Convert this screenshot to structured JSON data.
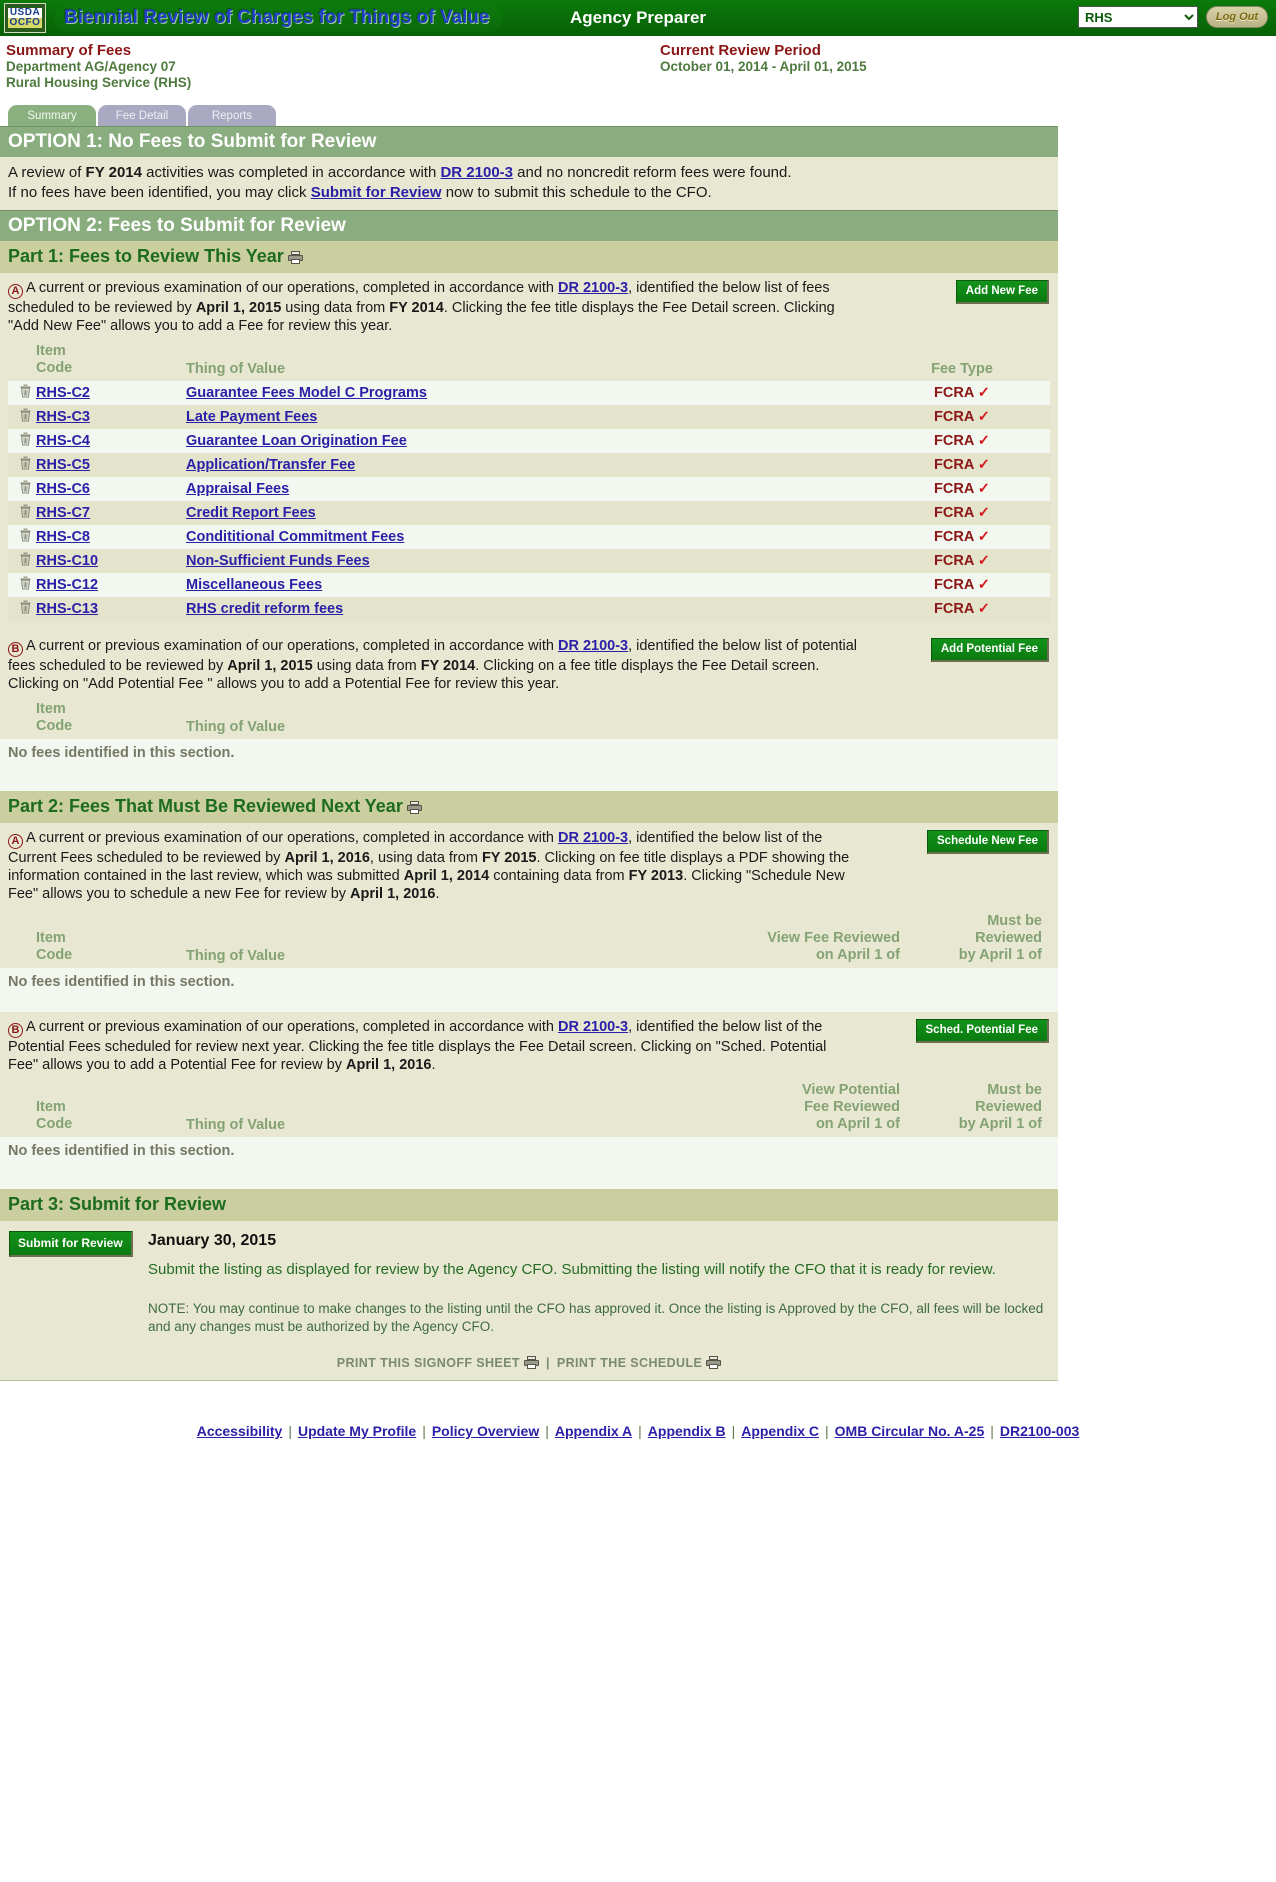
{
  "header": {
    "logo_line1": "USDA",
    "logo_line2": "OCFO",
    "app_title": "Biennial Review of Charges for Things of Value",
    "role": "Agency Preparer",
    "agency_selected": "RHS",
    "agency_options": [
      "RHS"
    ],
    "logout_label": "Log Out"
  },
  "titles": {
    "left_title": "Summary of Fees",
    "left_line2": "Department AG/Agency 07",
    "left_line3": "Rural Housing Service (RHS)",
    "right_title": "Current Review Period",
    "right_line2": "October 01, 2014 - April 01, 2015"
  },
  "tabs": [
    {
      "label": "Summary",
      "active": true
    },
    {
      "label": "Fee Detail",
      "active": false
    },
    {
      "label": "Reports",
      "active": false
    }
  ],
  "option1": {
    "heading": "OPTION 1: No Fees to Submit for Review",
    "line1_a": "A review of ",
    "line1_fy": "FY 2014",
    "line1_b": " activities was completed in accordance with ",
    "line1_link": "DR 2100-3",
    "line1_c": " and no noncredit reform fees were found.",
    "line2_a": "If no fees have been identified, you may click ",
    "line2_link": "Submit for Review",
    "line2_b": " now to submit this schedule to the CFO."
  },
  "option2": {
    "heading": "OPTION 2: Fees to Submit for Review"
  },
  "part1": {
    "heading": "Part 1: Fees to Review This Year",
    "sectionA": {
      "marker": "A",
      "text_1": "A current or previous examination of our operations, completed in accordance with ",
      "link": "DR 2100-3",
      "text_2": ", identified the below list of fees scheduled to be reviewed by ",
      "bold_1": "April 1, 2015",
      "text_3": " using data from ",
      "bold_2": "FY 2014",
      "text_4": ". Clicking the fee title displays the Fee Detail screen. Clicking \"Add New Fee\" allows you to add a Fee for review this year.",
      "button": "Add New Fee",
      "columns": {
        "item_code": "Item\nCode",
        "thing_of_value": "Thing of Value",
        "fee_type": "Fee Type"
      },
      "rows": [
        {
          "code": "RHS-C2",
          "name": "Guarantee Fees Model C Programs",
          "fee_type": "FCRA",
          "check": "✓"
        },
        {
          "code": "RHS-C3",
          "name": "Late Payment Fees",
          "fee_type": "FCRA",
          "check": "✓"
        },
        {
          "code": "RHS-C4",
          "name": "Guarantee Loan Origination Fee",
          "fee_type": "FCRA",
          "check": "✓"
        },
        {
          "code": "RHS-C5",
          "name": "Application/Transfer Fee",
          "fee_type": "FCRA",
          "check": "✓"
        },
        {
          "code": "RHS-C6",
          "name": "Appraisal Fees",
          "fee_type": "FCRA",
          "check": "✓"
        },
        {
          "code": "RHS-C7",
          "name": "Credit Report Fees",
          "fee_type": "FCRA",
          "check": "✓"
        },
        {
          "code": "RHS-C8",
          "name": "Conditition​al Commitment Fees",
          "fee_type": "FCRA",
          "check": "✓"
        },
        {
          "code": "RHS-C10",
          "name": "Non-Sufficient Funds Fees",
          "fee_type": "FCRA",
          "check": "✓"
        },
        {
          "code": "RHS-C12",
          "name": "Miscellaneous Fees",
          "fee_type": "FCRA",
          "check": "✓"
        },
        {
          "code": "RHS-C13",
          "name": "RHS credit reform fees",
          "fee_type": "FCRA",
          "check": "✓"
        }
      ]
    },
    "sectionB": {
      "marker": "B",
      "text_1": "A current or previous examination of our operations, completed in accordance with ",
      "link": "DR 2100-3",
      "text_2": ", identified the below list of potential fees scheduled to be reviewed by ",
      "bold_1": "April 1, 2015",
      "text_3": " using data from ",
      "bold_2": "FY 2014",
      "text_4": ". Clicking on a fee title displays the Fee Detail screen. Clicking on \"Add Potential Fee \" allows you to add a Potential Fee for review this year.",
      "button": "Add Potential Fee",
      "columns": {
        "item_code": "Item\nCode",
        "thing_of_value": "Thing of Value"
      },
      "empty_message": "No fees identified in this section."
    }
  },
  "part2": {
    "heading": "Part 2: Fees That Must Be Reviewed Next Year",
    "sectionA": {
      "marker": "A",
      "text_1": "A current or previous examination of our operations, completed in accordance with ",
      "link": "DR 2100-3",
      "text_2": ", identified the below list of the Current Fees scheduled to be reviewed by ",
      "bold_1": "April 1, 2016",
      "text_3": ", using data from ",
      "bold_2": "FY 2015",
      "text_4": ". Clicking on fee title displays a PDF showing the information contained in the last review, which was submitted ",
      "bold_3": "April 1, 2014",
      "text_5": " containing data from ",
      "bold_4": "FY 2013",
      "text_6": ". Clicking \"Schedule New Fee\" allows you to schedule a new Fee for review by ",
      "bold_5": "April 1, 2016",
      "text_7": ".",
      "button": "Schedule New Fee",
      "columns": {
        "item_code": "Item\nCode",
        "thing_of_value": "Thing of Value",
        "view_fee": "View Fee Reviewed\non April 1 of",
        "must_be": "Must be\nReviewed\nby April 1 of"
      },
      "empty_message": "No fees identified in this section."
    },
    "sectionB": {
      "marker": "B",
      "text_1": "A current or previous examination of our operations, completed in accordance with ",
      "link": "DR 2100-3",
      "text_2": ", identified the below list of the Potential Fees scheduled for review next year. Clicking the fee title displays the Fee Detail screen. Clicking on \"Sched. Potential Fee\" allows you to add a Potential Fee for review by ",
      "bold_1": "April 1, 2016",
      "text_3": ".",
      "button": "Sched. Potential Fee",
      "columns": {
        "item_code": "Item\nCode",
        "thing_of_value": "Thing of Value",
        "view_fee": "View Potential\nFee Reviewed\non April 1 of",
        "must_be": "Must be\nReviewed\nby April 1 of"
      },
      "empty_message": "No fees identified in this section."
    }
  },
  "part3": {
    "heading": "Part 3: Submit for Review",
    "button": "Submit for Review",
    "date": "January 30, 2015",
    "paragraph": "Submit the listing as displayed for review by the Agency CFO. Submitting the listing will notify the CFO that it is ready for review.",
    "note": "NOTE: You may continue to make changes to the listing until the CFO has approved it. Once the listing is Approved by the CFO, all fees will be locked and any changes must be authorized by the Agency CFO.",
    "print_signoff": "PRINT THIS SIGNOFF SHEET",
    "print_separator": "|",
    "print_schedule": "PRINT THE SCHEDULE"
  },
  "footer": {
    "links": [
      "Accessibility",
      "Update My Profile",
      "Policy Overview",
      "Appendix A",
      "Appendix B",
      "Appendix C",
      "OMB Circular No. A-25",
      "DR2100-003"
    ]
  },
  "icons": {
    "trash": "trash-icon",
    "printer": "printer-icon",
    "chevron": "chevron-down-icon"
  },
  "colors": {
    "brand_green": "#076b07",
    "panel_bg": "#e8e8d2",
    "header_band": "#89ad7e",
    "part_band": "#cbcf9f",
    "link_blue": "#2b1fa8",
    "title_red": "#8c1616",
    "accent_green": "#12931a"
  }
}
